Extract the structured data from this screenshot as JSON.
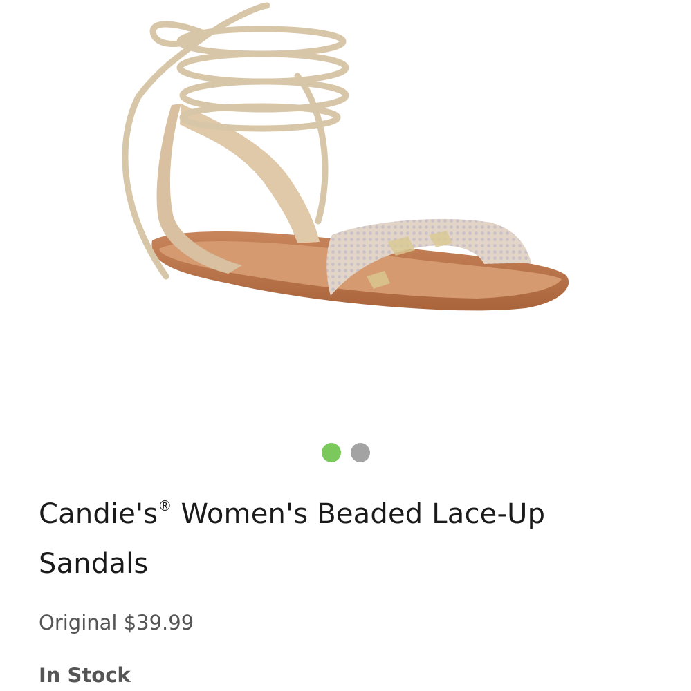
{
  "carousel": {
    "slide_count": 2,
    "active_index": 0,
    "active_color": "#7bc95c",
    "inactive_color": "#a3a3a3"
  },
  "product": {
    "image_icon": "sandal-product-photo",
    "brand": "Candie's",
    "trademark": "®",
    "title_rest": " Women's Beaded Lace-Up Sandals",
    "price_label": "Original",
    "price_value": "$39.99",
    "stock_status": "In Stock"
  }
}
